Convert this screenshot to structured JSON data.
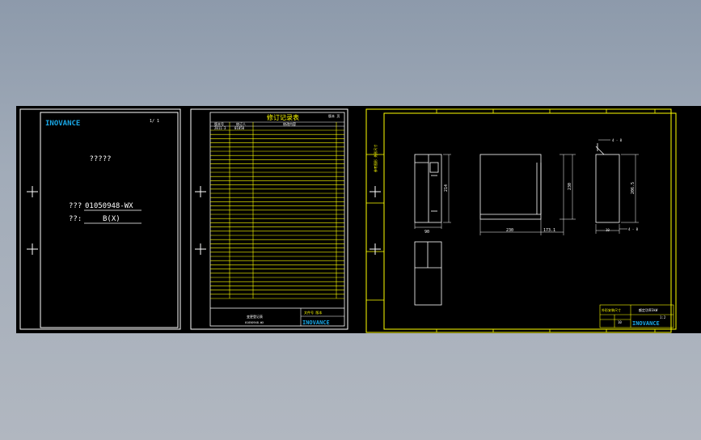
{
  "colors": {
    "background": "#000000",
    "frame_white": "#ffffff",
    "frame_yellow": "#ffff00",
    "brand_cyan": "#19a7e6",
    "app_background_top": "#8d9aab",
    "app_background_bottom": "#b1b7c0"
  },
  "sheet1": {
    "logo": "INOVANCE",
    "page_mark": "1/   1",
    "title": "?????",
    "code_label": "???",
    "code_value": "01050948-WX",
    "version_label": "??:",
    "version_value": "B(X)"
  },
  "sheet2": {
    "title": "修订记录表",
    "corner_label": "版本 页",
    "header_cols": [
      "版本号",
      "修订人",
      "修改内容"
    ],
    "first_row": [
      "2011-3",
      "01050",
      ""
    ],
    "footer_caption": "变更登记表",
    "footer_code": "01050948-WX",
    "footer_right": "文件号  版本",
    "logo": "INOVANCE"
  },
  "sheet3": {
    "side_label": "参考图形 外形尺寸",
    "dimensions": {
      "front_width": "90",
      "front_height": "214",
      "side_width": "230",
      "side_height": "230",
      "side_extra": "173.1",
      "rear_height": "206.5",
      "rear_width": "10",
      "rear_hole_top": "4 - 8",
      "rear_hole_bottom": "4 - 8"
    },
    "title_block": {
      "left_label": "外形安装尺寸",
      "right_label": "额定功率3kW",
      "scale": "1:2",
      "sheet_no": "10",
      "logo": "INOVANCE"
    }
  }
}
